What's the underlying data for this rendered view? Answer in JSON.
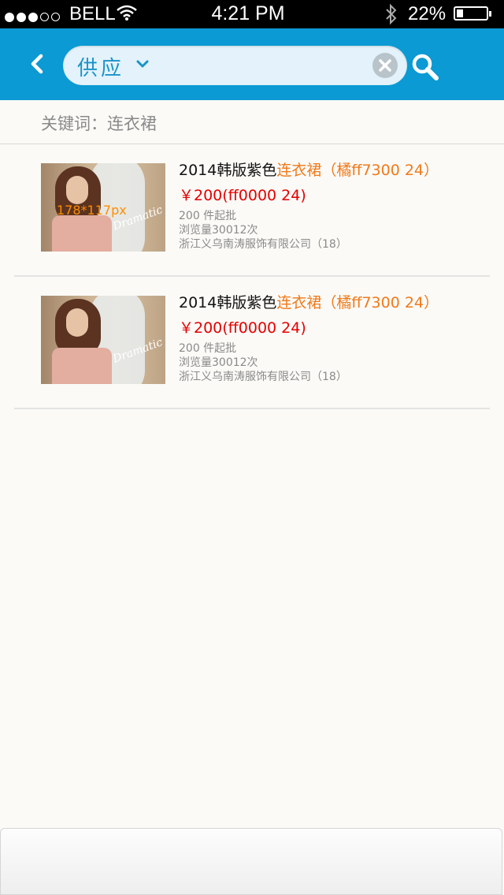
{
  "status_bar": {
    "carrier": "BELL",
    "time": "4:21 PM",
    "battery_percent": "22%",
    "battery_level": 0.22,
    "signal_bars_filled": 3,
    "signal_bars_total": 5
  },
  "nav": {
    "search_type": "供应",
    "icons": [
      "chevron-left-icon",
      "chevron-down-icon",
      "clear-icon",
      "search-icon"
    ],
    "colors": {
      "bar": "#0b9ad3",
      "search_bg": "#e3f2fb",
      "search_text": "#1a93c8"
    }
  },
  "keyword": {
    "label": "关键词：连衣裙"
  },
  "results": [
    {
      "title_prefix": "2014韩版紫色",
      "title_highlight": "连衣裙（橘ff7300 24）",
      "price": "￥200(ff0000 24)",
      "min_order": "200 件起批",
      "views": "浏览量30012次",
      "company": "浙江义乌南涛服饰有限公司（18）",
      "thumb_placeholder": "178*117px"
    },
    {
      "title_prefix": "2014韩版紫色",
      "title_highlight": "连衣裙（橘ff7300 24）",
      "price": "￥200(ff0000 24)",
      "min_order": "200 件起批",
      "views": "浏览量30012次",
      "company": "浙江义乌南涛服饰有限公司（18）",
      "thumb_placeholder": ""
    }
  ],
  "colors": {
    "highlight": "#f07a1a",
    "price": "#e60000",
    "meta": "#8a8a8a"
  }
}
